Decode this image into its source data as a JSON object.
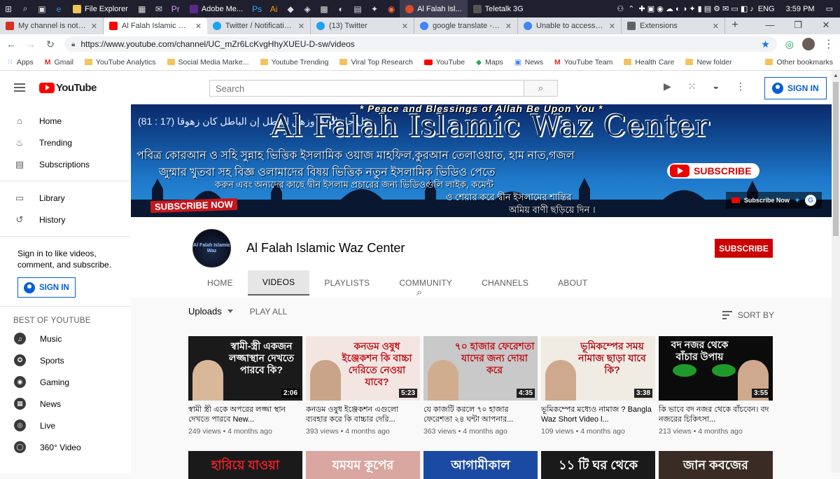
{
  "taskbar": {
    "apps": [
      {
        "label": "File Explorer",
        "color": "#f4c35a"
      },
      {
        "label": "Adobe Me...",
        "color": "#5a2a8a"
      },
      {
        "label": "Al Falah Isl...",
        "color": "#e04a2a"
      },
      {
        "label": "Teletalk 3G",
        "color": "#222222"
      }
    ],
    "lang": "ENG",
    "time": "3:59 PM"
  },
  "tabs": [
    {
      "title": "My channel is not work",
      "fav": "#d93025",
      "active": false
    },
    {
      "title": "Al Falah Islamic Waz Ce",
      "fav": "#ff0000",
      "active": true
    },
    {
      "title": "Twitter / Notifications",
      "fav": "#1da1f2",
      "active": false
    },
    {
      "title": "(13) Twitter",
      "fav": "#1da1f2",
      "active": false
    },
    {
      "title": "google translate - Goo",
      "fav": "#4285f4",
      "active": false
    },
    {
      "title": "Unable to access a Goo",
      "fav": "#4285f4",
      "active": false
    },
    {
      "title": "Extensions",
      "fav": "#5f6368",
      "active": false
    }
  ],
  "address": {
    "url": "https://www.youtube.com/channel/UC_mZr6LcKvgHhyXUEU-D-sw/videos"
  },
  "bookmarks": [
    {
      "label": "Apps",
      "type": "apps"
    },
    {
      "label": "Gmail",
      "type": "gmail"
    },
    {
      "label": "YouTube Analytics",
      "type": "folder"
    },
    {
      "label": "Social Media Marke...",
      "type": "folder"
    },
    {
      "label": "Youtube Trending",
      "type": "folder"
    },
    {
      "label": "Viral Top Research",
      "type": "folder"
    },
    {
      "label": "YouTube",
      "type": "yt"
    },
    {
      "label": "Maps",
      "type": "maps"
    },
    {
      "label": "News",
      "type": "news"
    },
    {
      "label": "YouTube Team",
      "type": "gmail"
    },
    {
      "label": "Health Care",
      "type": "folder"
    },
    {
      "label": "New folder",
      "type": "folder"
    }
  ],
  "other_bookmarks": "Other bookmarks",
  "header": {
    "logo": "YouTube",
    "search_placeholder": "Search",
    "signin": "SIGN IN"
  },
  "sidebar": {
    "main": [
      {
        "label": "Home",
        "icon": "⌂"
      },
      {
        "label": "Trending",
        "icon": "♨"
      },
      {
        "label": "Subscriptions",
        "icon": "▤"
      }
    ],
    "library": [
      {
        "label": "Library",
        "icon": "▭"
      },
      {
        "label": "History",
        "icon": "↺"
      }
    ],
    "signin_prompt": "Sign in to like videos, comment, and subscribe.",
    "signin_button": "SIGN IN",
    "best_heading": "BEST OF YOUTUBE",
    "best": [
      {
        "label": "Music",
        "icon": "♫"
      },
      {
        "label": "Sports",
        "icon": "✪"
      },
      {
        "label": "Gaming",
        "icon": "◉"
      },
      {
        "label": "News",
        "icon": "▦"
      },
      {
        "label": "Live",
        "icon": "◎"
      },
      {
        "label": "360° Video",
        "icon": "◯"
      }
    ]
  },
  "banner": {
    "top": "* Peace and Blessings of Allah Be Upon You *",
    "big": "Al Falah Islamic Waz Center",
    "arabic": "وقل جاء الحق وزهق الباطل إن الباطل كان زهوقا (17 : 81)",
    "line1": "পবিত্র কোরআন ও সহি সুন্নাহ ভিত্তিক ইসলামিক ওয়াজ মাহফিল,কুরআন তেলাওয়াত, হাম নাত,গজল",
    "line2": "জুম্মার খুতবা সহ বিজ্ঞ ওলামাদের বিষয় ভিত্তিক নতুন ইসলামিক ভিডিও পেতে",
    "line3": "করুন এবং অন্যদের কাছে দ্বীন ইসলাম প্রচারের জন্য ভিডিওগুলি লাইক, কমেন্ট",
    "line4": "ও শেয়ার করে দ্বীন ইসলামের শান্তির",
    "line5": "অমিয় বাণী ছড়িয়ে দিন ।",
    "subscribe": "SUBSCRIBE",
    "subscribe_now": "SUBSCRIBE NOW",
    "overlay": "Subscribe Now"
  },
  "channel": {
    "avatar_text": "Al Falah Islamic Waz",
    "name": "Al Falah Islamic Waz Center",
    "subscribe": "SUBSCRIBE",
    "tabs": [
      "HOME",
      "VIDEOS",
      "PLAYLISTS",
      "COMMUNITY",
      "CHANNELS",
      "ABOUT"
    ],
    "active_tab": "VIDEOS"
  },
  "toolbar": {
    "uploads": "Uploads",
    "play_all": "PLAY ALL",
    "sort": "SORT BY"
  },
  "videos": [
    {
      "thumb_text": "স্বামী-স্ত্রী একজন লজ্জাস্থান দেখতে পারবে কি?",
      "bg": "#1a1a1a",
      "fg": "#ffffff",
      "duration": "2:06",
      "title": "স্বামী স্ত্রী একে অপরের লজ্জা স্থান দেখতে পারবে New...",
      "views": "249 views",
      "age": "4 months ago"
    },
    {
      "thumb_text": "কনডম ওষুধ ইঞ্জেকশন কি বাচ্চা দেরিতে নেওয়া যাবে?",
      "bg": "#f3e6e2",
      "fg": "#c0121a",
      "duration": "5:23",
      "title": "কনডম ওষুধ ইঞ্জেকশন এগুলো ব্যবহার করে কি বাচ্চার দেরি...",
      "views": "393 views",
      "age": "4 months ago"
    },
    {
      "thumb_text": "৭০ হাজার ফেরেশতা যাদের জন্য দোয়া করে",
      "bg": "#c9c9c9",
      "fg": "#c0121a",
      "duration": "4:35",
      "title": "যে কাজটি করলে ৭০ হাজার ফেরেশতা ২৪ ঘন্টা আপনার...",
      "views": "363 views",
      "age": "4 months ago"
    },
    {
      "thumb_text": "ভূমিকম্পের সময় নামাজ ছাড়া যাবে কি?",
      "bg": "#f0ece4",
      "fg": "#b0101a",
      "duration": "3:38",
      "title": "ভূমিকম্পের মধ্যেও নামাজ ? Bangla Waz Short Video l...",
      "views": "109 views",
      "age": "4 months ago"
    },
    {
      "thumb_text": "বদ নজর থেকে বাঁচার উপায়",
      "bg": "#0b0b0b",
      "fg": "#ffffff",
      "duration": "3:55",
      "title": "কি ভাবে বদ নজর থেকে বাঁচবেন। বদ নজরের চিকিৎসা...",
      "views": "213 views",
      "age": "4 months ago"
    }
  ],
  "videos_row2": [
    {
      "thumb_text": "হারিয়ে যাওয়া",
      "bg": "#1a1a1a",
      "fg": "#e8202a"
    },
    {
      "thumb_text": "যমযম কূপের",
      "bg": "#d9a6a0",
      "fg": "#ffffff"
    },
    {
      "thumb_text": "আগামীকাল",
      "bg": "#1b4aa3",
      "fg": "#ffffff"
    },
    {
      "thumb_text": "১১ টি ঘর থেকে",
      "bg": "#1a1a1a",
      "fg": "#ffffff"
    },
    {
      "thumb_text": "জান কবজের",
      "bg": "#3a2c25",
      "fg": "#ffffff"
    }
  ]
}
